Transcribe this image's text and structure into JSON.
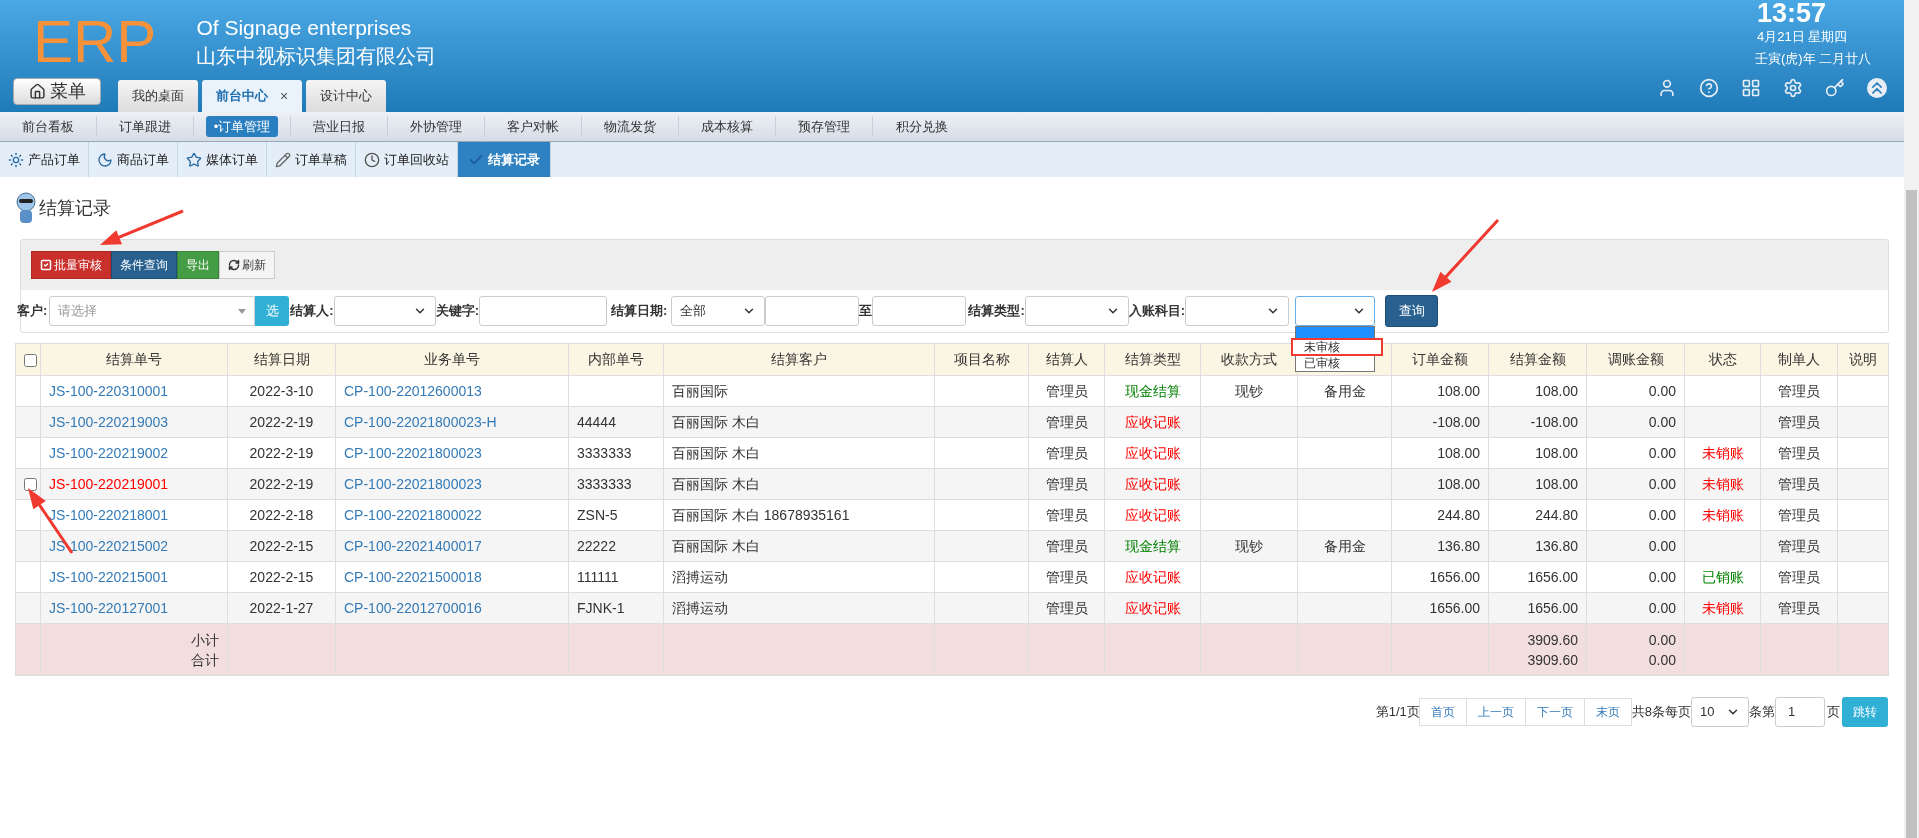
{
  "header": {
    "logo": "ERP",
    "company_en": "Of Signage enterprises",
    "company_cn": "山东中视标识集团有限公司",
    "menu_button": "菜单",
    "clock": {
      "time": "13:57",
      "date": "4月21日 星期四",
      "lunar": "壬寅(虎)年 二月廿八"
    }
  },
  "tabs": [
    {
      "label": "我的桌面",
      "selected": false,
      "closable": false
    },
    {
      "label": "前台中心",
      "selected": true,
      "closable": true,
      "close": "×"
    },
    {
      "label": "设计中心",
      "selected": false,
      "closable": false
    }
  ],
  "nav": [
    {
      "label": "前台看板",
      "selected": false
    },
    {
      "label": "订单跟进",
      "selected": false
    },
    {
      "label": "•订单管理",
      "selected": true
    },
    {
      "label": "营业日报",
      "selected": false
    },
    {
      "label": "外协管理",
      "selected": false
    },
    {
      "label": "客户对帐",
      "selected": false
    },
    {
      "label": "物流发货",
      "selected": false
    },
    {
      "label": "成本核算",
      "selected": false
    },
    {
      "label": "预存管理",
      "selected": false
    },
    {
      "label": "积分兑换",
      "selected": false
    }
  ],
  "subnav": [
    {
      "label": "产品订单",
      "kind": "sun",
      "selected": false
    },
    {
      "label": "商品订单",
      "kind": "moon",
      "selected": false
    },
    {
      "label": "媒体订单",
      "kind": "star",
      "selected": false
    },
    {
      "label": "订单草稿",
      "kind": "pencil",
      "selected": false
    },
    {
      "label": "订单回收站",
      "kind": "clock",
      "selected": false
    },
    {
      "label": "结算记录",
      "kind": "check",
      "selected": true
    }
  ],
  "page_title": "结算记录",
  "toolbar": [
    {
      "label": "批量审核",
      "kind": "danger"
    },
    {
      "label": "条件查询",
      "kind": "primary"
    },
    {
      "label": "导出",
      "kind": "success"
    },
    {
      "label": "刷新",
      "kind": "default"
    }
  ],
  "filters": {
    "customer_label": "客户:",
    "customer_placeholder": "请选择",
    "pick_button": "选",
    "settler_label": "结算人:",
    "keyword_label": "关键字:",
    "date_label": "结算日期:",
    "date_range": "全部",
    "to_label": "至",
    "type_label": "结算类型:",
    "account_label": "入账科目:",
    "audit_options": [
      {
        "label": "未审核",
        "highlighted": true
      },
      {
        "label": "已审核",
        "highlighted": false
      }
    ],
    "search_button": "查询"
  },
  "table": {
    "select_all_checked": false,
    "columns": [
      {
        "label": "结算单号"
      },
      {
        "label": "结算日期"
      },
      {
        "label": "业务单号"
      },
      {
        "label": "内部单号"
      },
      {
        "label": "结算客户"
      },
      {
        "label": "项目名称"
      },
      {
        "label": "结算人"
      },
      {
        "label": "结算类型"
      },
      {
        "label": "收款方式"
      },
      {},
      {
        "label": "订单金额"
      },
      {
        "label": "结算金额"
      },
      {
        "label": "调账金额"
      },
      {
        "label": "状态"
      },
      {
        "label": "制单人"
      },
      {
        "label": "说明"
      }
    ],
    "rows": [
      {
        "no": "JS-100-220310001",
        "date": "2022-3-10",
        "biz_no": "CP-100-22012600013",
        "customer": "百丽国际",
        "settler": "管理员",
        "settle_type": {
          "text": "现金结算",
          "color": "#008000"
        },
        "pay_method": "现钞",
        "account": "备用金",
        "order_amount": "108.00",
        "settle_amount": "108.00",
        "adjust_amount": "0.00",
        "maker": "管理员",
        "highlighted": false
      },
      {
        "no": "JS-100-220219003",
        "date": "2022-2-19",
        "biz_no": "CP-100-22021800023-H",
        "inner_no": "44444",
        "customer": "百丽国际 木白",
        "settler": "管理员",
        "settle_type": {
          "text": "应收记账",
          "color": "#ff0000"
        },
        "order_amount": "-108.00",
        "settle_amount": "-108.00",
        "adjust_amount": "0.00",
        "maker": "管理员",
        "highlighted": false
      },
      {
        "no": "JS-100-220219002",
        "date": "2022-2-19",
        "biz_no": "CP-100-22021800023",
        "inner_no": "3333333",
        "customer": "百丽国际 木白",
        "settler": "管理员",
        "settle_type": {
          "text": "应收记账",
          "color": "#ff0000"
        },
        "order_amount": "108.00",
        "settle_amount": "108.00",
        "adjust_amount": "0.00",
        "status": {
          "text": "未销账",
          "color": "#ff0000"
        },
        "maker": "管理员",
        "highlighted": false
      },
      {
        "no": "JS-100-220219001",
        "date": "2022-2-19",
        "biz_no": "CP-100-22021800023",
        "inner_no": "3333333",
        "customer": "百丽国际 木白",
        "settler": "管理员",
        "settle_type": {
          "text": "应收记账",
          "color": "#ff0000"
        },
        "order_amount": "108.00",
        "settle_amount": "108.00",
        "adjust_amount": "0.00",
        "status": {
          "text": "未销账",
          "color": "#ff0000"
        },
        "maker": "管理员",
        "highlighted": true
      },
      {
        "no": "JS-100-220218001",
        "date": "2022-2-18",
        "biz_no": "CP-100-22021800022",
        "inner_no": "ZSN-5",
        "customer": "百丽国际 木白 18678935161",
        "settler": "管理员",
        "settle_type": {
          "text": "应收记账",
          "color": "#ff0000"
        },
        "order_amount": "244.80",
        "settle_amount": "244.80",
        "adjust_amount": "0.00",
        "status": {
          "text": "未销账",
          "color": "#ff0000"
        },
        "maker": "管理员",
        "highlighted": false
      },
      {
        "no": "JS-100-220215002",
        "date": "2022-2-15",
        "biz_no": "CP-100-22021400017",
        "inner_no": "22222",
        "customer": "百丽国际 木白",
        "settler": "管理员",
        "settle_type": {
          "text": "现金结算",
          "color": "#008000"
        },
        "pay_method": "现钞",
        "account": "备用金",
        "order_amount": "136.80",
        "settle_amount": "136.80",
        "adjust_amount": "0.00",
        "maker": "管理员",
        "highlighted": false
      },
      {
        "no": "JS-100-220215001",
        "date": "2022-2-15",
        "biz_no": "CP-100-22021500018",
        "inner_no": "111111",
        "customer": "滔搏运动",
        "settler": "管理员",
        "settle_type": {
          "text": "应收记账",
          "color": "#ff0000"
        },
        "order_amount": "1656.00",
        "settle_amount": "1656.00",
        "adjust_amount": "0.00",
        "status": {
          "text": "已销账",
          "color": "#008000"
        },
        "maker": "管理员",
        "highlighted": false
      },
      {
        "no": "JS-100-220127001",
        "date": "2022-1-27",
        "biz_no": "CP-100-22012700016",
        "inner_no": "FJNK-1",
        "customer": "滔搏运动",
        "settler": "管理员",
        "settle_type": {
          "text": "应收记账",
          "color": "#ff0000"
        },
        "order_amount": "1656.00",
        "settle_amount": "1656.00",
        "adjust_amount": "0.00",
        "status": {
          "text": "未销账",
          "color": "#ff0000"
        },
        "maker": "管理员",
        "highlighted": false
      }
    ],
    "footer": [
      {
        "label": "小计",
        "settle_amount": "3909.60",
        "adjust_amount": "0.00"
      },
      {
        "label": "合计",
        "settle_amount": "3909.60",
        "adjust_amount": "0.00"
      }
    ]
  },
  "pagination": {
    "page_info": "第1/1页",
    "buttons": [
      "首页",
      "上一页",
      "下一页",
      "末页"
    ],
    "total": "共8条每页",
    "page_size": "10",
    "per_label": "条第",
    "page": "1",
    "page_label": "页",
    "jump": "跳转"
  }
}
